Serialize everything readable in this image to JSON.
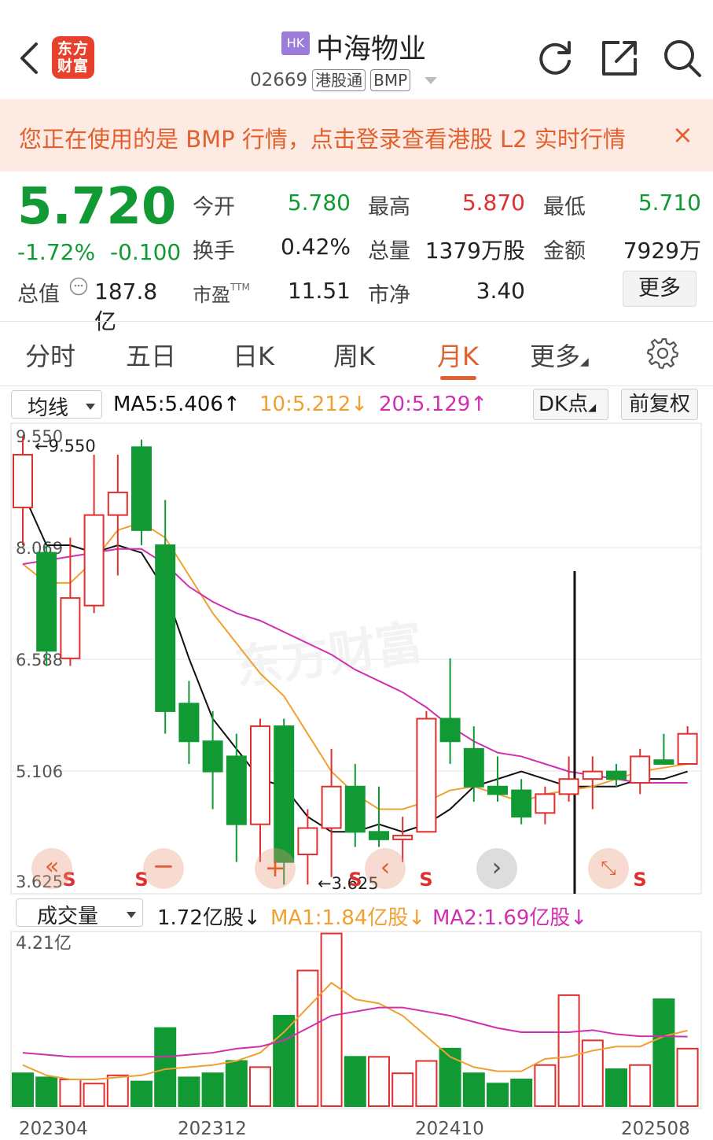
{
  "header": {
    "market_badge": "HK",
    "stock_name": "中海物业",
    "stock_code": "02669",
    "tags": [
      "港股通",
      "BMP"
    ],
    "logo_text": "东方财富"
  },
  "banner": {
    "text": "您正在使用的是 BMP 行情，点击登录查看港股 L2 实时行情",
    "close": "×"
  },
  "quote": {
    "price": "5.720",
    "change_pct": "-1.72%",
    "change_amt": "-0.100",
    "market_cap_label": "总值",
    "market_cap_value": "187.8亿",
    "fields": [
      {
        "label": "今开",
        "value": "5.780",
        "color": "#119a34"
      },
      {
        "label": "最高",
        "value": "5.870",
        "color": "#e02f2f"
      },
      {
        "label": "最低",
        "value": "5.710",
        "color": "#119a34"
      },
      {
        "label": "换手",
        "value": "0.42%",
        "color": "#222222"
      },
      {
        "label": "总量",
        "value": "1379万股",
        "color": "#222222"
      },
      {
        "label": "金额",
        "value": "7929万",
        "color": "#222222"
      },
      {
        "label": "市盈",
        "value": "11.51",
        "color": "#222222"
      },
      {
        "label": "市净",
        "value": "3.40",
        "color": "#222222"
      }
    ],
    "pe_sup": "TTM",
    "more_label": "更多"
  },
  "tabs": [
    {
      "label": "分时"
    },
    {
      "label": "五日"
    },
    {
      "label": "日K"
    },
    {
      "label": "周K"
    },
    {
      "label": "月K",
      "active": true
    },
    {
      "label": "更多"
    }
  ],
  "indicator_bar": {
    "selector": "均线",
    "ma5": "MA5:5.406↑",
    "ma10": "10:5.212↓",
    "ma20": "20:5.129↑",
    "dk_label": "DK点",
    "adjust_label": "前复权"
  },
  "volume_bar": {
    "selector": "成交量",
    "vol": "1.72亿股↓",
    "ma1": "MA1:1.84亿股↓",
    "ma2": "MA2:1.69亿股↓"
  },
  "colors": {
    "up": "#e02f2f",
    "down": "#119a34",
    "ma5": "#111111",
    "ma10": "#f0a030",
    "ma20": "#d030b0",
    "accent": "#e1602d"
  },
  "chart_data": [
    {
      "type": "candlestick",
      "title": "",
      "y_ticks": [
        "9.550",
        "8.069",
        "6.588",
        "5.106",
        "3.625"
      ],
      "ylim": [
        3.625,
        9.55
      ],
      "annotations": [
        "←9.550",
        "←3.625"
      ],
      "signals": [
        "S",
        "S",
        "S",
        "S",
        "S"
      ],
      "series": [
        {
          "open": 8.6,
          "close": 9.3,
          "high": 9.55,
          "low": 8.1
        },
        {
          "open": 8.0,
          "close": 6.7,
          "high": 8.1,
          "low": 6.5
        },
        {
          "open": 6.6,
          "close": 7.4,
          "high": 8.2,
          "low": 6.5
        },
        {
          "open": 7.3,
          "close": 8.5,
          "high": 9.3,
          "low": 7.2
        },
        {
          "open": 8.5,
          "close": 8.8,
          "high": 9.3,
          "low": 7.7
        },
        {
          "open": 9.4,
          "close": 8.3,
          "high": 9.5,
          "low": 8.1
        },
        {
          "open": 8.1,
          "close": 5.9,
          "high": 8.7,
          "low": 5.6
        },
        {
          "open": 6.0,
          "close": 5.5,
          "high": 6.3,
          "low": 5.2
        },
        {
          "open": 5.5,
          "close": 5.1,
          "high": 5.9,
          "low": 4.6
        },
        {
          "open": 5.3,
          "close": 4.4,
          "high": 5.6,
          "low": 3.9
        },
        {
          "open": 4.4,
          "close": 5.7,
          "high": 5.8,
          "low": 3.9
        },
        {
          "open": 5.7,
          "close": 3.9,
          "high": 5.8,
          "low": 3.6
        },
        {
          "open": 4.0,
          "close": 4.35,
          "high": 4.6,
          "low": 3.6
        },
        {
          "open": 4.35,
          "close": 4.9,
          "high": 5.4,
          "low": 3.7
        },
        {
          "open": 4.9,
          "close": 4.3,
          "high": 5.2,
          "low": 4.1
        },
        {
          "open": 4.3,
          "close": 4.2,
          "high": 4.9,
          "low": 4.1
        },
        {
          "open": 4.2,
          "close": 4.25,
          "high": 4.5,
          "low": 3.9
        },
        {
          "open": 4.3,
          "close": 5.8,
          "high": 5.9,
          "low": 4.3
        },
        {
          "open": 5.8,
          "close": 5.5,
          "high": 6.6,
          "low": 5.2
        },
        {
          "open": 5.4,
          "close": 4.9,
          "high": 5.7,
          "low": 4.7
        },
        {
          "open": 4.9,
          "close": 4.8,
          "high": 5.3,
          "low": 4.7
        },
        {
          "open": 4.85,
          "close": 4.5,
          "high": 5.0,
          "low": 4.4
        },
        {
          "open": 4.55,
          "close": 4.8,
          "high": 4.9,
          "low": 4.4
        },
        {
          "open": 4.8,
          "close": 5.0,
          "high": 5.3,
          "low": 4.7
        },
        {
          "open": 5.0,
          "close": 5.1,
          "high": 5.3,
          "low": 4.6
        },
        {
          "open": 5.1,
          "close": 5.0,
          "high": 5.2,
          "low": 4.9
        },
        {
          "open": 4.95,
          "close": 5.3,
          "high": 5.4,
          "low": 4.8
        },
        {
          "open": 5.25,
          "close": 5.2,
          "high": 5.6,
          "low": 5.2
        },
        {
          "open": 5.2,
          "close": 5.6,
          "high": 5.7,
          "low": 5.2
        }
      ],
      "ma5": [
        8.8,
        8.1,
        8.1,
        8.0,
        8.1,
        8.0,
        7.5,
        6.6,
        5.8,
        5.4,
        5.0,
        4.9,
        4.5,
        4.3,
        4.3,
        4.4,
        4.3,
        4.4,
        4.6,
        4.9,
        5.0,
        5.1,
        5.0,
        4.9,
        4.9,
        4.9,
        5.0,
        5.0,
        5.1
      ],
      "ma10": [
        7.85,
        7.6,
        7.6,
        7.9,
        8.3,
        8.4,
        8.2,
        7.7,
        7.2,
        6.8,
        6.4,
        6.1,
        5.6,
        5.1,
        4.8,
        4.6,
        4.6,
        4.7,
        4.85,
        4.9,
        4.8,
        4.7,
        4.8,
        4.85,
        4.9,
        5.0,
        5.1,
        5.15,
        5.2
      ],
      "ma20": [
        7.85,
        7.9,
        7.95,
        8.0,
        8.05,
        8.05,
        7.85,
        7.55,
        7.35,
        7.2,
        7.1,
        6.95,
        6.8,
        6.65,
        6.45,
        6.3,
        6.15,
        5.95,
        5.7,
        5.5,
        5.35,
        5.3,
        5.2,
        5.1,
        5.05,
        5.0,
        4.95,
        4.95,
        4.95
      ]
    },
    {
      "type": "bar",
      "title": "",
      "y_max_label": "4.21亿",
      "ylim": [
        0,
        4.21
      ],
      "x_ticks": [
        "202304",
        "202312",
        "202410",
        "202508"
      ],
      "values": [
        0.8,
        0.7,
        0.65,
        0.55,
        0.75,
        0.6,
        1.9,
        0.7,
        0.8,
        1.1,
        0.95,
        2.2,
        3.3,
        4.2,
        1.2,
        1.2,
        0.8,
        1.1,
        1.4,
        0.8,
        0.55,
        0.65,
        1.0,
        2.7,
        1.6,
        0.9,
        1.0,
        2.6,
        1.4
      ],
      "up": [
        false,
        false,
        true,
        true,
        true,
        false,
        false,
        false,
        false,
        false,
        true,
        false,
        true,
        true,
        false,
        true,
        true,
        true,
        false,
        false,
        false,
        false,
        true,
        true,
        true,
        false,
        true,
        false,
        true
      ],
      "ma1": [
        1.0,
        0.75,
        0.65,
        0.65,
        0.7,
        0.75,
        0.9,
        0.95,
        1.0,
        1.1,
        1.3,
        1.8,
        2.4,
        3.0,
        2.6,
        2.5,
        2.2,
        1.7,
        1.2,
        0.95,
        0.85,
        0.85,
        1.15,
        1.2,
        1.35,
        1.45,
        1.45,
        1.7,
        1.84
      ],
      "ma2": [
        1.3,
        1.25,
        1.2,
        1.2,
        1.2,
        1.2,
        1.2,
        1.25,
        1.3,
        1.4,
        1.45,
        1.6,
        1.9,
        2.2,
        2.3,
        2.4,
        2.4,
        2.3,
        2.2,
        2.05,
        1.9,
        1.8,
        1.8,
        1.8,
        1.85,
        1.75,
        1.7,
        1.7,
        1.69
      ]
    }
  ]
}
